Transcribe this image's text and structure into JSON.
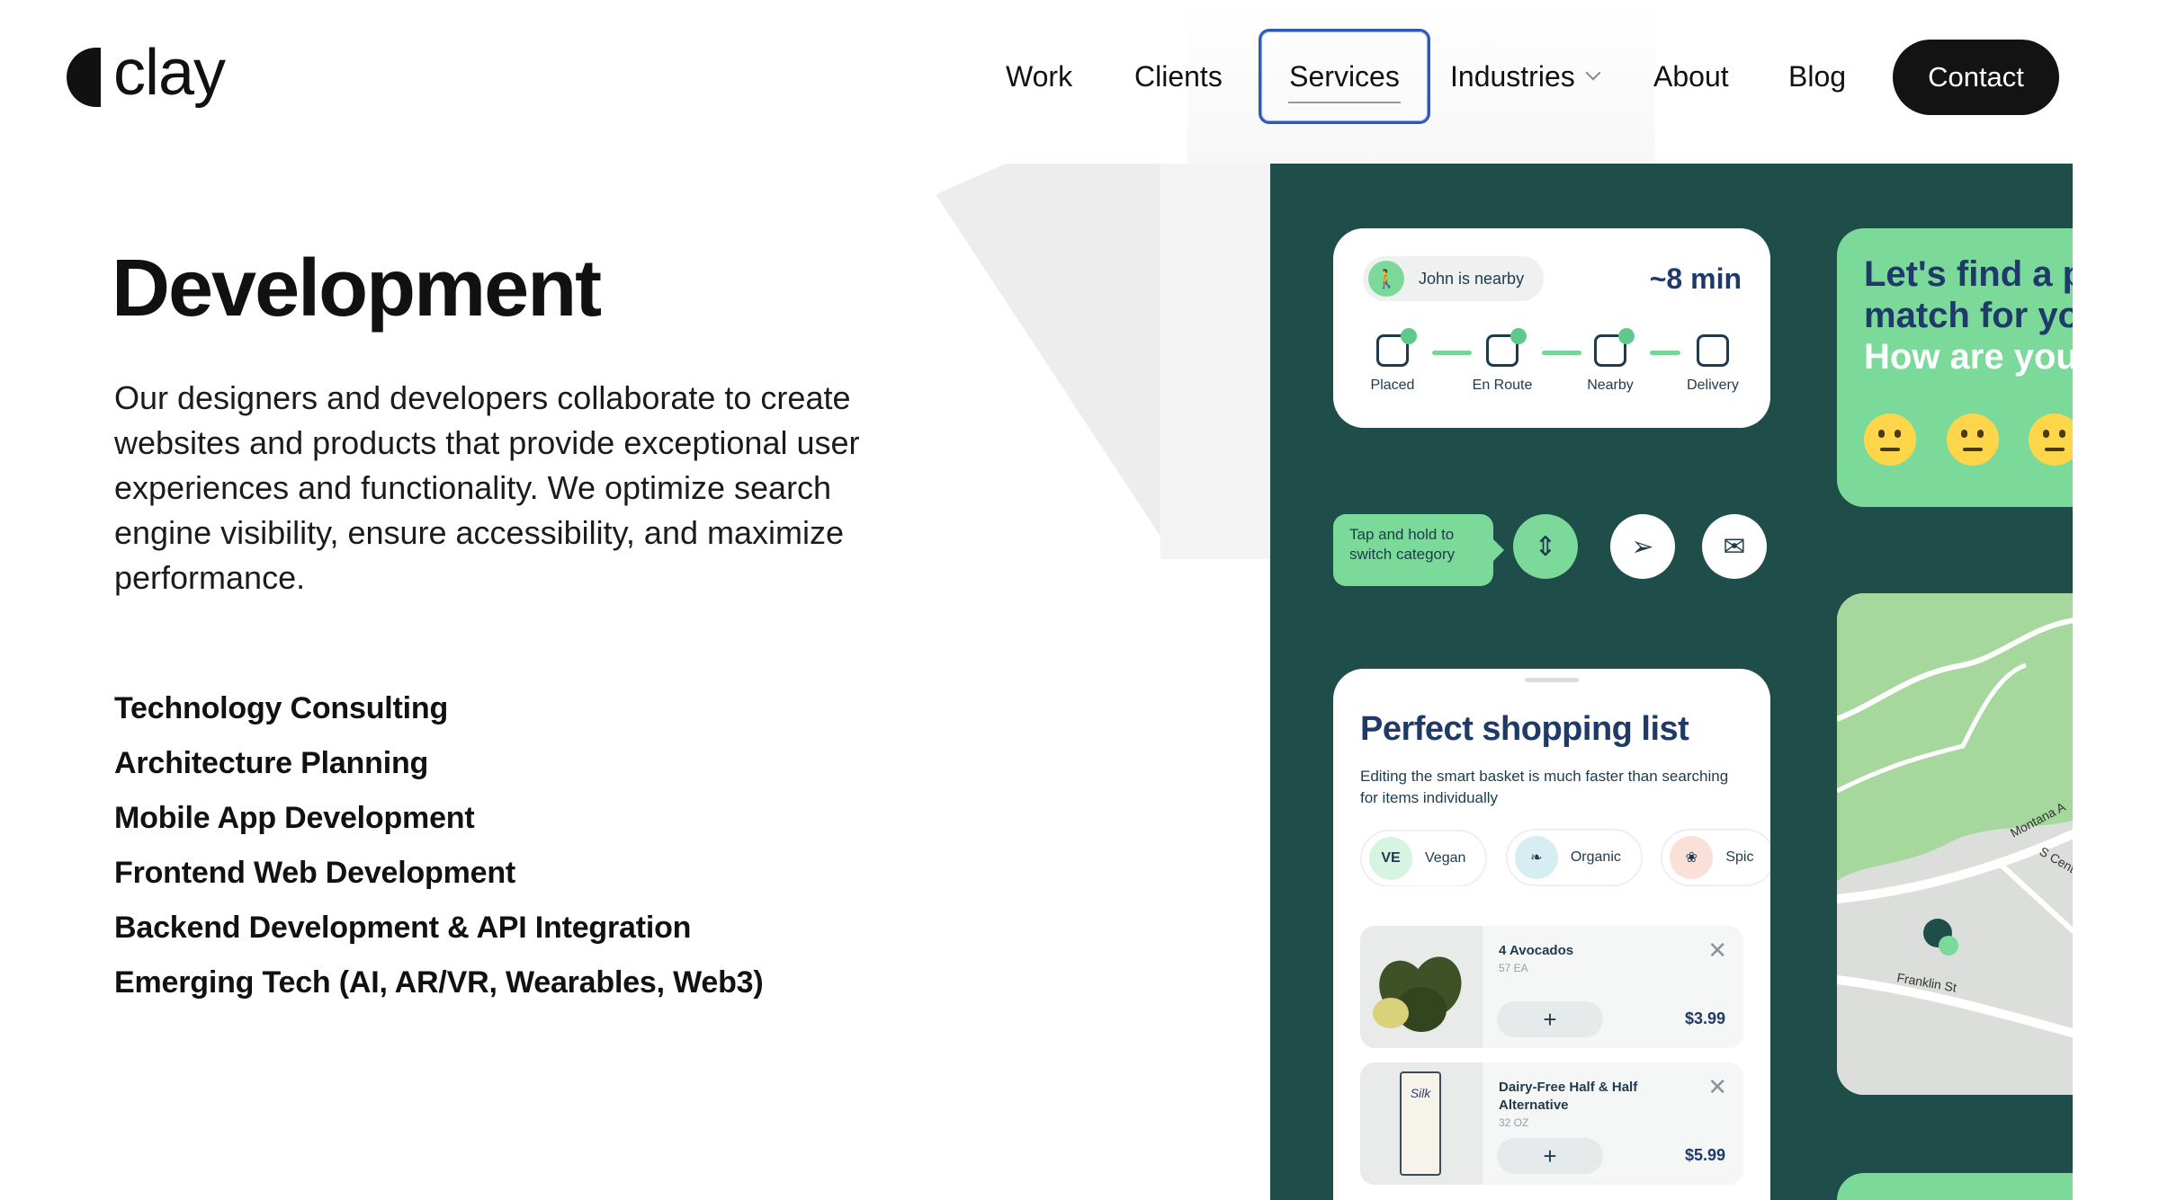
{
  "brand": {
    "name": "clay"
  },
  "nav": {
    "items": [
      {
        "label": "Work"
      },
      {
        "label": "Clients"
      },
      {
        "label": "Services"
      },
      {
        "label": "Industries"
      },
      {
        "label": "About"
      },
      {
        "label": "Blog"
      }
    ],
    "contact_label": "Contact",
    "active": "Services"
  },
  "hero": {
    "title": "Development",
    "description": "Our designers and developers collaborate to create websites and products that provide exceptional user experiences and functionality. We optimize search engine visibility, ensure accessibility, and maximize performance."
  },
  "services": [
    "Technology Consulting",
    "Architecture Planning",
    "Mobile App Development",
    "Frontend Web Development",
    "Backend Development & API Integration",
    "Emerging Tech (AI, AR/VR, Wearables, Web3)"
  ],
  "showcase": {
    "tracking": {
      "status": "John is nearby",
      "eta": "~8 min",
      "steps": [
        "Placed",
        "En Route",
        "Nearby",
        "Delivery"
      ]
    },
    "tip": "Tap and hold to switch category",
    "shopping": {
      "title": "Perfect shopping list",
      "subtitle": "Editing the smart basket is much faster than searching for items individually",
      "chips": [
        "Vegan",
        "Organic",
        "Spic"
      ],
      "items": [
        {
          "name": "4 Avocados",
          "qty": "57 EA",
          "price": "$3.99"
        },
        {
          "name": "Dairy-Free Half & Half Alternative",
          "qty": "32 OZ",
          "price": "$5.99"
        }
      ]
    },
    "mood": {
      "line1": "Let's find a p",
      "line2": "match for yo",
      "line3": "How are you"
    },
    "map": {
      "streets": [
        "Montana A",
        "S Cent",
        "Franklin St"
      ]
    },
    "colors": {
      "panel": "#1f4d4a",
      "accent_green": "#7bd99a",
      "navy": "#1f3a68",
      "focus_ring": "#2f59b8"
    }
  }
}
